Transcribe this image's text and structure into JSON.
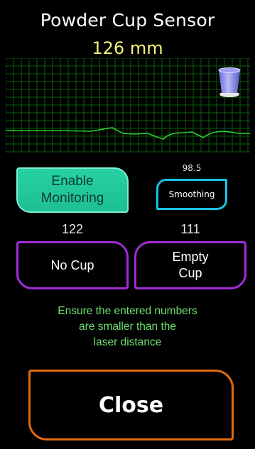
{
  "header": {
    "title": "Powder Cup Sensor",
    "distance": "126 mm"
  },
  "graph": {
    "grid_color": "#0b5e0b",
    "line_color": "#2bd12b"
  },
  "cup_icon": "powder-cup-icon",
  "monitoring": {
    "enable_label_line1": "Enable",
    "enable_label_line2": "Monitoring",
    "smoothing_value": "98.5",
    "smoothing_label": "Smoothing"
  },
  "thresholds": {
    "no_cup_value": "122",
    "empty_cup_value": "111",
    "no_cup_label": "No Cup",
    "empty_cup_label_line1": "Empty",
    "empty_cup_label_line2": "Cup"
  },
  "note": {
    "line1": "Ensure the entered numbers",
    "line2": "are smaller than the",
    "line3": "laser distance"
  },
  "close_label": "Close",
  "colors": {
    "enable_button": "#1fc79a",
    "smoothing_border": "#19c4e6",
    "cup_button_border": "#a22bd9",
    "close_border": "#e06a10",
    "note_text": "#6fe06f",
    "distance_text": "#f2f27a"
  }
}
